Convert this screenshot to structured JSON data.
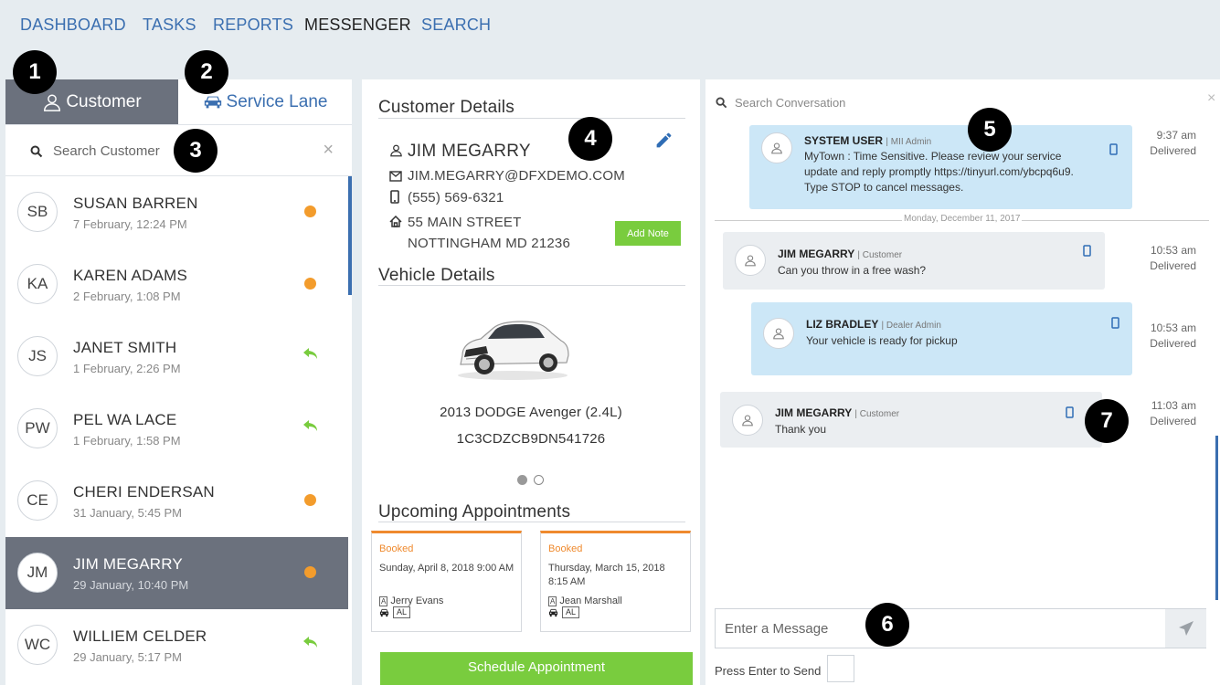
{
  "nav": {
    "items": [
      {
        "label": "DASHBOARD"
      },
      {
        "label": "TASKS"
      },
      {
        "label": "REPORTS"
      },
      {
        "label": "MESSENGER"
      },
      {
        "label": "SEARCH"
      }
    ],
    "active": "MESSENGER"
  },
  "markers": [
    "1",
    "2",
    "3",
    "4",
    "5",
    "6",
    "7"
  ],
  "tabs": {
    "customer": "Customer",
    "service_lane": "Service Lane"
  },
  "customer_search": {
    "placeholder": "Search Customer",
    "clear": "×"
  },
  "customers": [
    {
      "initials": "SB",
      "name": "SUSAN BARREN",
      "date": "7 February, 12:24 PM",
      "status": "unread"
    },
    {
      "initials": "KA",
      "name": "KAREN ADAMS",
      "date": "2 February, 1:08 PM",
      "status": "unread"
    },
    {
      "initials": "JS",
      "name": "JANET SMITH",
      "date": "1 February, 2:26 PM",
      "status": "replied"
    },
    {
      "initials": "PW",
      "name": "PEL WA LACE",
      "date": "1 February, 1:58 PM",
      "status": "replied"
    },
    {
      "initials": "CE",
      "name": "CHERI ENDERSAN",
      "date": "31 January, 5:45 PM",
      "status": "unread"
    },
    {
      "initials": "JM",
      "name": "JIM MEGARRY",
      "date": "29 January, 10:40 PM",
      "status": "unread",
      "selected": true
    },
    {
      "initials": "WC",
      "name": "WILLIEM CELDER",
      "date": "29 January, 5:17 PM",
      "status": "replied"
    }
  ],
  "customer_details": {
    "title": "Customer Details",
    "name": "JIM MEGARRY",
    "email": "JIM.MEGARRY@DFXDEMO.COM",
    "phone": "(555) 569-6321",
    "address_line1": "55 MAIN STREET",
    "address_line2": "NOTTINGHAM MD 21236",
    "add_note": "Add Note"
  },
  "vehicle_details": {
    "title": "Vehicle Details",
    "model": "2013 DODGE Avenger (2.4L)",
    "vin": "1C3CDZCB9DN541726"
  },
  "appointments": {
    "title": "Upcoming Appointments",
    "items": [
      {
        "status": "Booked",
        "when_line1": "Sunday, April 8, 2018 9:00 AM",
        "when_line2": "",
        "person": "Jerry Evans",
        "person_tag": "A",
        "code": "AL"
      },
      {
        "status": "Booked",
        "when_line1": "Thursday, March 15, 2018",
        "when_line2": "8:15 AM",
        "person": "Jean Marshall",
        "person_tag": "A",
        "code": "AL"
      }
    ],
    "schedule_button": "Schedule Appointment"
  },
  "conversation": {
    "search_placeholder": "Search Conversation",
    "clear": "×",
    "day_separator": "Monday, December 11, 2017",
    "messages": [
      {
        "sender": "SYSTEM USER",
        "role": "| MII Admin",
        "lines": [
          "MyTown : Time Sensitive. Please review your service",
          "update and reply promptly https://tinyurl.com/ybcpq6u9.",
          "Type STOP to cancel messages."
        ],
        "time": "9:37 am",
        "status": "Delivered",
        "direction": "out"
      },
      {
        "sender": "JIM MEGARRY",
        "role": "| Customer",
        "lines": [
          "Can you throw in a free wash?"
        ],
        "time": "10:53 am",
        "status": "Delivered",
        "direction": "in"
      },
      {
        "sender": "LIZ BRADLEY",
        "role": "| Dealer Admin",
        "lines": [
          "Your vehicle is ready for pickup"
        ],
        "time": "10:53 am",
        "status": "Delivered",
        "direction": "out"
      },
      {
        "sender": "JIM MEGARRY",
        "role": "| Customer",
        "lines": [
          "Thank you"
        ],
        "time": "11:03 am",
        "status": "Delivered",
        "direction": "in"
      }
    ],
    "compose_placeholder": "Enter a Message",
    "press_enter_label": "Press Enter to Send"
  },
  "colors": {
    "nav_link": "#3b6fb0",
    "selected_row": "#6b717d",
    "unread_dot": "#f39c2c",
    "reply_arrow": "#79cc3e",
    "accent_green": "#79cc3e",
    "booked_orange": "#ef8a2e",
    "outgoing_bubble": "#cce7f7",
    "incoming_bubble": "#ebeef1"
  },
  "icons": {
    "customer_tab": "user-icon",
    "service_tab": "car-icon",
    "search": "search-icon",
    "edit": "pencil-icon",
    "email": "envelope-icon",
    "phone": "mobile-phone-icon",
    "address": "home-icon",
    "reply": "reply-arrow-icon",
    "send": "send-arrow-icon"
  }
}
